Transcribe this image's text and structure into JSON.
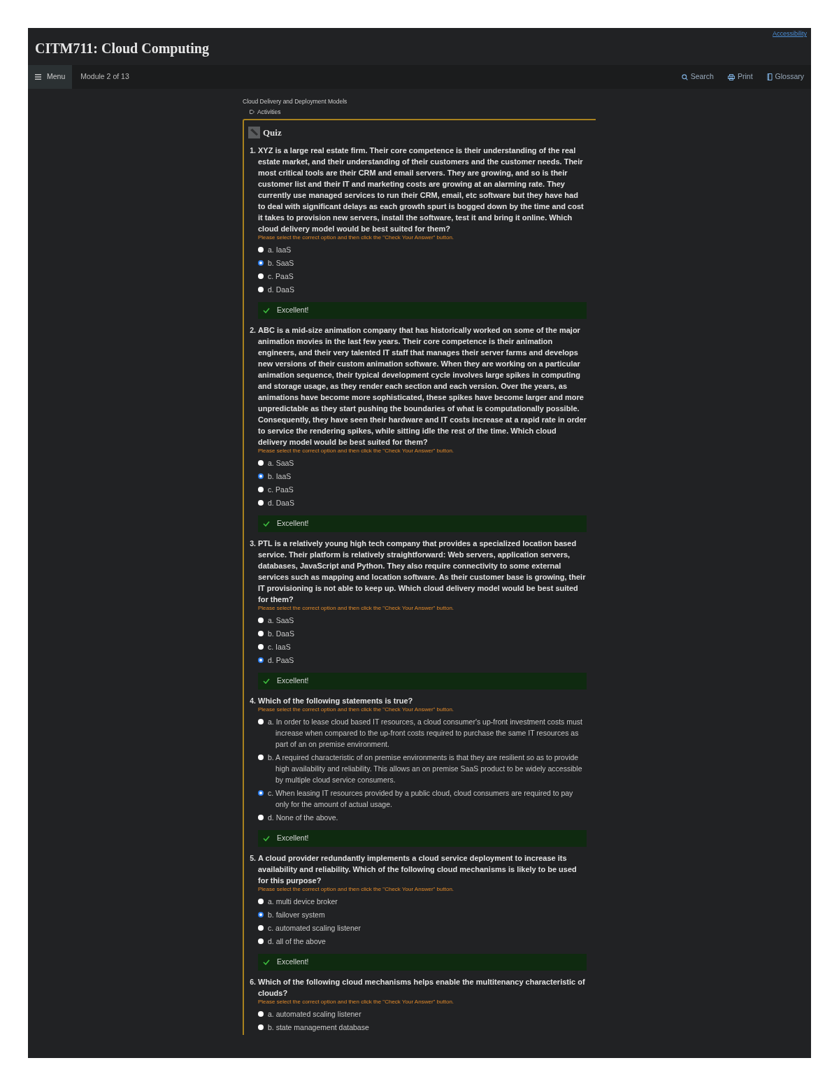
{
  "course_title": "CITM711: Cloud Computing",
  "accessibility_link": "Accessibility",
  "nav": {
    "menu_label": "Menu",
    "module": "Module 2 of 13",
    "actions": [
      {
        "kind": "search",
        "label": "Search"
      },
      {
        "kind": "print",
        "label": "Print"
      },
      {
        "kind": "glossary",
        "label": "Glossary"
      }
    ]
  },
  "breadcrumb": "Cloud Delivery and Deployment Models",
  "section": "Activities",
  "quiz": {
    "title": "Quiz",
    "questions": [
      {
        "number": "1.",
        "text": "XYZ is a large real estate firm. Their core competence is their understanding of the real estate market, and their understanding of their customers and the customer needs. Their most critical tools are their CRM and email servers. They are growing, and so is their customer list and their IT and marketing costs are growing at an alarming rate. They currently use managed services to run their CRM, email, etc software but they have had to deal with significant delays as each growth spurt is bogged down by the time and cost it takes to provision new servers, install the software, test it and bring it online. Which cloud delivery model would be best suited for them?",
        "instruction": "Please select the correct option and then click the \"Check Your Answer\" button.",
        "options": [
          {
            "label": "a. IaaS",
            "selected": false
          },
          {
            "label": "b. SaaS",
            "selected": true
          },
          {
            "label": "c. PaaS",
            "selected": false
          },
          {
            "label": "d. DaaS",
            "selected": false
          }
        ],
        "feedback": "Excellent!"
      },
      {
        "number": "2.",
        "text": "ABC is a mid-size animation company that has historically worked on some of the major animation movies in the last few years. Their core competence is their animation engineers, and their very talented IT staff that manages their server farms and develops new versions of their custom animation software. When they are working on a particular animation sequence, their typical development cycle involves large spikes in computing and storage usage, as they render each section and each version. Over the years, as animations have become more sophisticated, these spikes have become larger and more unpredictable as they start pushing the boundaries of what is computationally possible. Consequently, they have seen their hardware and IT costs increase at a rapid rate in order to service the rendering spikes, while sitting idle the rest of the time. Which cloud delivery model would be best suited for them?",
        "instruction": "Please select the correct option and then click the \"Check Your Answer\" button.",
        "options": [
          {
            "label": "a. SaaS",
            "selected": false
          },
          {
            "label": "b. IaaS",
            "selected": true
          },
          {
            "label": "c. PaaS",
            "selected": false
          },
          {
            "label": "d. DaaS",
            "selected": false
          }
        ],
        "feedback": "Excellent!"
      },
      {
        "number": "3.",
        "text": "PTL is a relatively young high tech company that provides a specialized location based service. Their platform is relatively straightforward: Web servers, application servers, databases, JavaScript and Python. They also require connectivity to some external services such as mapping and location software. As their customer base is growing, their IT provisioning is not able to keep up. Which cloud delivery model would be best suited for them?",
        "instruction": "Please select the correct option and then click the \"Check Your Answer\" button.",
        "options": [
          {
            "label": "a. SaaS",
            "selected": false
          },
          {
            "label": "b. DaaS",
            "selected": false
          },
          {
            "label": "c. IaaS",
            "selected": false
          },
          {
            "label": "d. PaaS",
            "selected": true
          }
        ],
        "feedback": "Excellent!"
      },
      {
        "number": "4.",
        "text": "Which of the following statements is true?",
        "instruction": "Please select the correct option and then click the \"Check Your Answer\" button.",
        "options": [
          {
            "label": "a. In order to lease cloud based IT resources, a cloud consumer's up-front investment costs must increase when compared to the up-front costs required to purchase the same IT resources as part of an on premise environment.",
            "selected": false
          },
          {
            "label": "b. A required characteristic of on premise environments is that they are resilient so as to provide high availability and reliability. This allows an on premise SaaS product to be widely accessible by multiple cloud service consumers.",
            "selected": false
          },
          {
            "label": "c. When leasing IT resources provided by a public cloud, cloud consumers are required to pay only for the amount of actual usage.",
            "selected": true
          },
          {
            "label": "d. None of the above.",
            "selected": false
          }
        ],
        "feedback": "Excellent!"
      },
      {
        "number": "5.",
        "text": "A cloud provider redundantly implements a cloud service deployment to increase its availability and reliability. Which of the following cloud mechanisms is likely to be used for this purpose?",
        "instruction": "Please select the correct option and then click the \"Check Your Answer\" button.",
        "options": [
          {
            "label": "a. multi device broker",
            "selected": false
          },
          {
            "label": "b. failover system",
            "selected": true
          },
          {
            "label": "c. automated scaling listener",
            "selected": false
          },
          {
            "label": "d. all of the above",
            "selected": false
          }
        ],
        "feedback": "Excellent!"
      },
      {
        "number": "6.",
        "text": "Which of the following cloud mechanisms helps enable the multitenancy characteristic of clouds?",
        "instruction": "Please select the correct option and then click the \"Check Your Answer\" button.",
        "options": [
          {
            "label": "a. automated scaling listener",
            "selected": false
          },
          {
            "label": "b. state management database",
            "selected": false
          }
        ]
      }
    ]
  }
}
